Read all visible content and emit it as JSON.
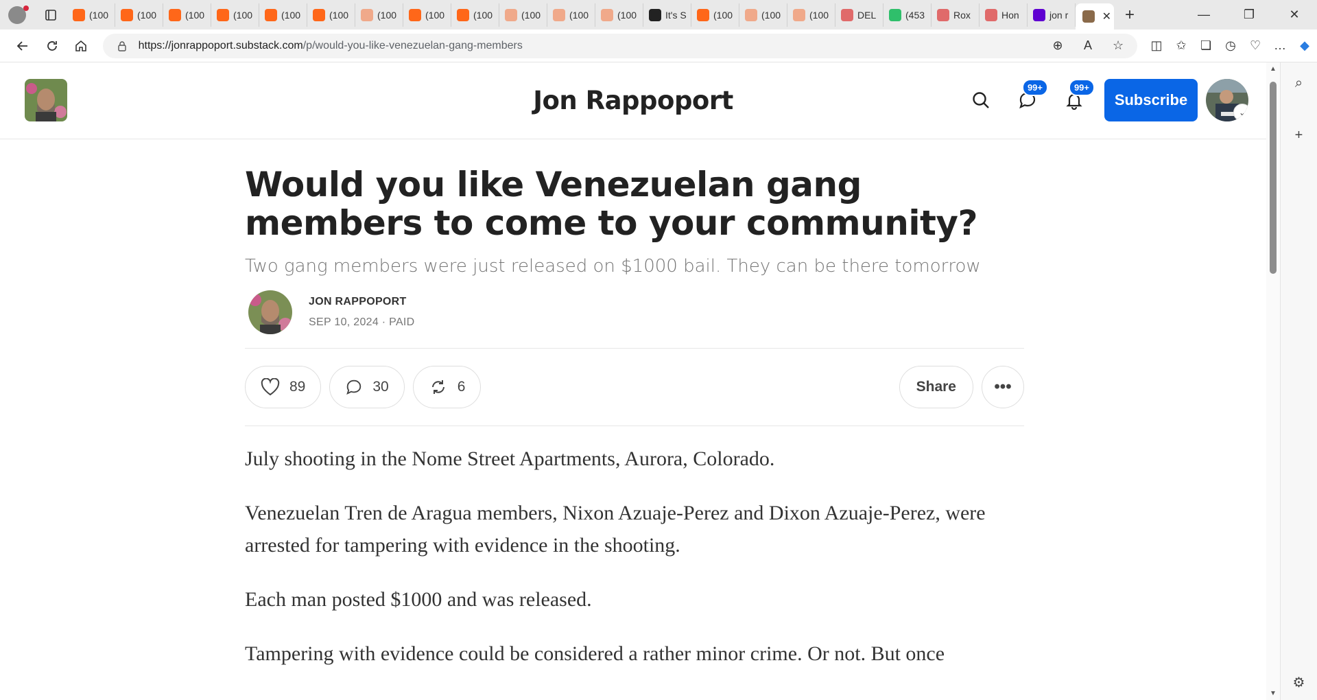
{
  "browser": {
    "tabs": [
      {
        "label": "(100",
        "color": "#ff6719"
      },
      {
        "label": "(100",
        "color": "#ff6719"
      },
      {
        "label": "(100",
        "color": "#ff6719"
      },
      {
        "label": "(100",
        "color": "#ff6719"
      },
      {
        "label": "(100",
        "color": "#ff6719"
      },
      {
        "label": "(100",
        "color": "#ff6719"
      },
      {
        "label": "(100",
        "color": "#f0a98a"
      },
      {
        "label": "(100",
        "color": "#ff6719"
      },
      {
        "label": "(100",
        "color": "#ff6719"
      },
      {
        "label": "(100",
        "color": "#f0a98a"
      },
      {
        "label": "(100",
        "color": "#f0a98a"
      },
      {
        "label": "(100",
        "color": "#f0a98a"
      },
      {
        "label": "It's S",
        "color": "#222222"
      },
      {
        "label": "(100",
        "color": "#ff6719"
      },
      {
        "label": "(100",
        "color": "#f0a98a"
      },
      {
        "label": "(100",
        "color": "#f0a98a"
      },
      {
        "label": "DEL",
        "color": "#e06a6a"
      },
      {
        "label": "(453",
        "color": "#2fbf6b"
      },
      {
        "label": "Rox",
        "color": "#e06a6a"
      },
      {
        "label": "Hon",
        "color": "#e06a6a"
      },
      {
        "label": "jon r",
        "color": "#5f01d1"
      }
    ],
    "active_tab_close": "✕",
    "new_tab": "+",
    "url_host": "https://jonrappoport.substack.com",
    "url_path": "/p/would-you-like-venezuelan-gang-members",
    "colors": {
      "accent": "#0a66e6"
    }
  },
  "header": {
    "site_title": "Jon Rappoport",
    "chat_badge": "99+",
    "notif_badge": "99+",
    "subscribe_label": "Subscribe"
  },
  "article": {
    "title": "Would you like Venezuelan gang members to come to your community?",
    "subtitle": "Two gang members were just released on $1000 bail. They can be there tomorrow",
    "author": "JON RAPPOPORT",
    "date_line": "SEP 10, 2024 · PAID",
    "likes": "89",
    "comments": "30",
    "restacks": "6",
    "share_label": "Share",
    "more_label": "•••",
    "paragraphs": [
      "July shooting in the Nome Street Apartments, Aurora, Colorado.",
      "Venezuelan Tren de Aragua members, Nixon Azuaje-Perez and Dixon Azuaje-Perez, were arrested for tampering with evidence in the shooting.",
      "Each man posted $1000 and was released.",
      "Tampering with evidence could be considered a rather minor crime. Or not. But once"
    ]
  }
}
